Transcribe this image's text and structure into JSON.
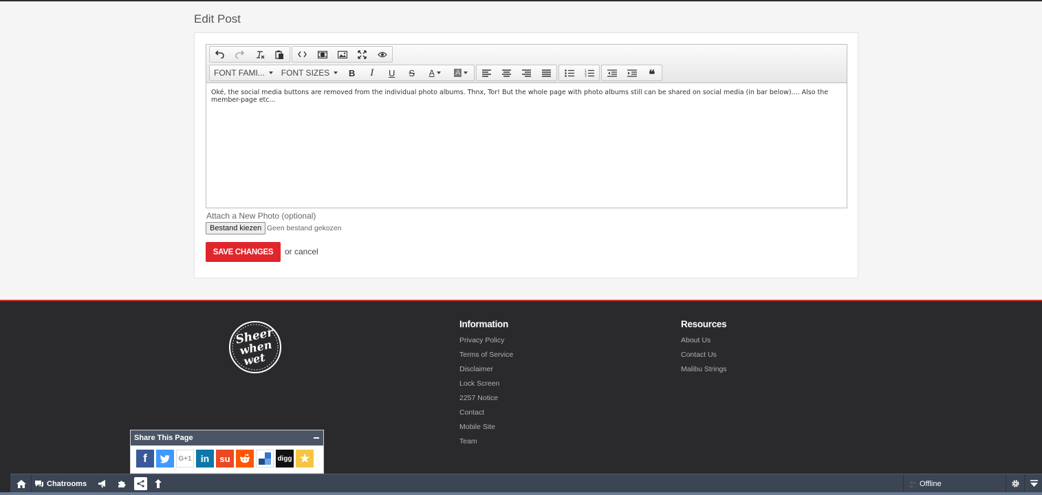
{
  "page": {
    "title": "Edit Post"
  },
  "editor": {
    "font_family_label": "FONT FAMI...",
    "font_sizes_label": "FONT SIZES",
    "content": "Oké, the social media buttons are removed from the individual photo albums. Thnx, Tor! But the whole page with photo albums still can be shared on social media (in bar below).... Also the member-page etc..."
  },
  "form": {
    "attach_label": "Attach a New Photo (optional)",
    "file_button": "Bestand kiezen",
    "file_status": "Geen bestand gekozen",
    "save_label": "SAVE CHANGES",
    "cancel_text": "or cancel"
  },
  "footer": {
    "logo_text": "Sheer when wet",
    "information": {
      "heading": "Information",
      "links": [
        "Privacy Policy",
        "Terms of Service",
        "Disclaimer",
        "Lock Screen",
        "2257 Notice",
        "Contact",
        "Mobile Site",
        "Team"
      ]
    },
    "resources": {
      "heading": "Resources",
      "links": [
        "About Us",
        "Contact Us",
        "Malibu Strings"
      ]
    }
  },
  "share": {
    "title": "Share This Page",
    "icons": [
      {
        "name": "facebook-icon",
        "glyph": "f",
        "color": "#3b5998"
      },
      {
        "name": "twitter-icon",
        "glyph": "t",
        "color": "#4099ff"
      },
      {
        "name": "google-plus-icon",
        "glyph": "G+1",
        "color": "#ffffff"
      },
      {
        "name": "linkedin-icon",
        "glyph": "in",
        "color": "#0e76a8"
      },
      {
        "name": "stumbleupon-icon",
        "glyph": "su",
        "color": "#eb4924"
      },
      {
        "name": "reddit-icon",
        "glyph": "r",
        "color": "#ff5700"
      },
      {
        "name": "delicious-icon",
        "glyph": "d",
        "color": "#3274d1"
      },
      {
        "name": "digg-icon",
        "glyph": "digg",
        "color": "#111111"
      },
      {
        "name": "favorites-icon",
        "glyph": "★",
        "color": "#f5c542"
      }
    ]
  },
  "bottombar": {
    "chatrooms": "Chatrooms",
    "status": "Offline"
  },
  "colors": {
    "accent": "#e0262c",
    "footer_bg": "#2a2a2c",
    "bar_bg": "#3c4554"
  }
}
